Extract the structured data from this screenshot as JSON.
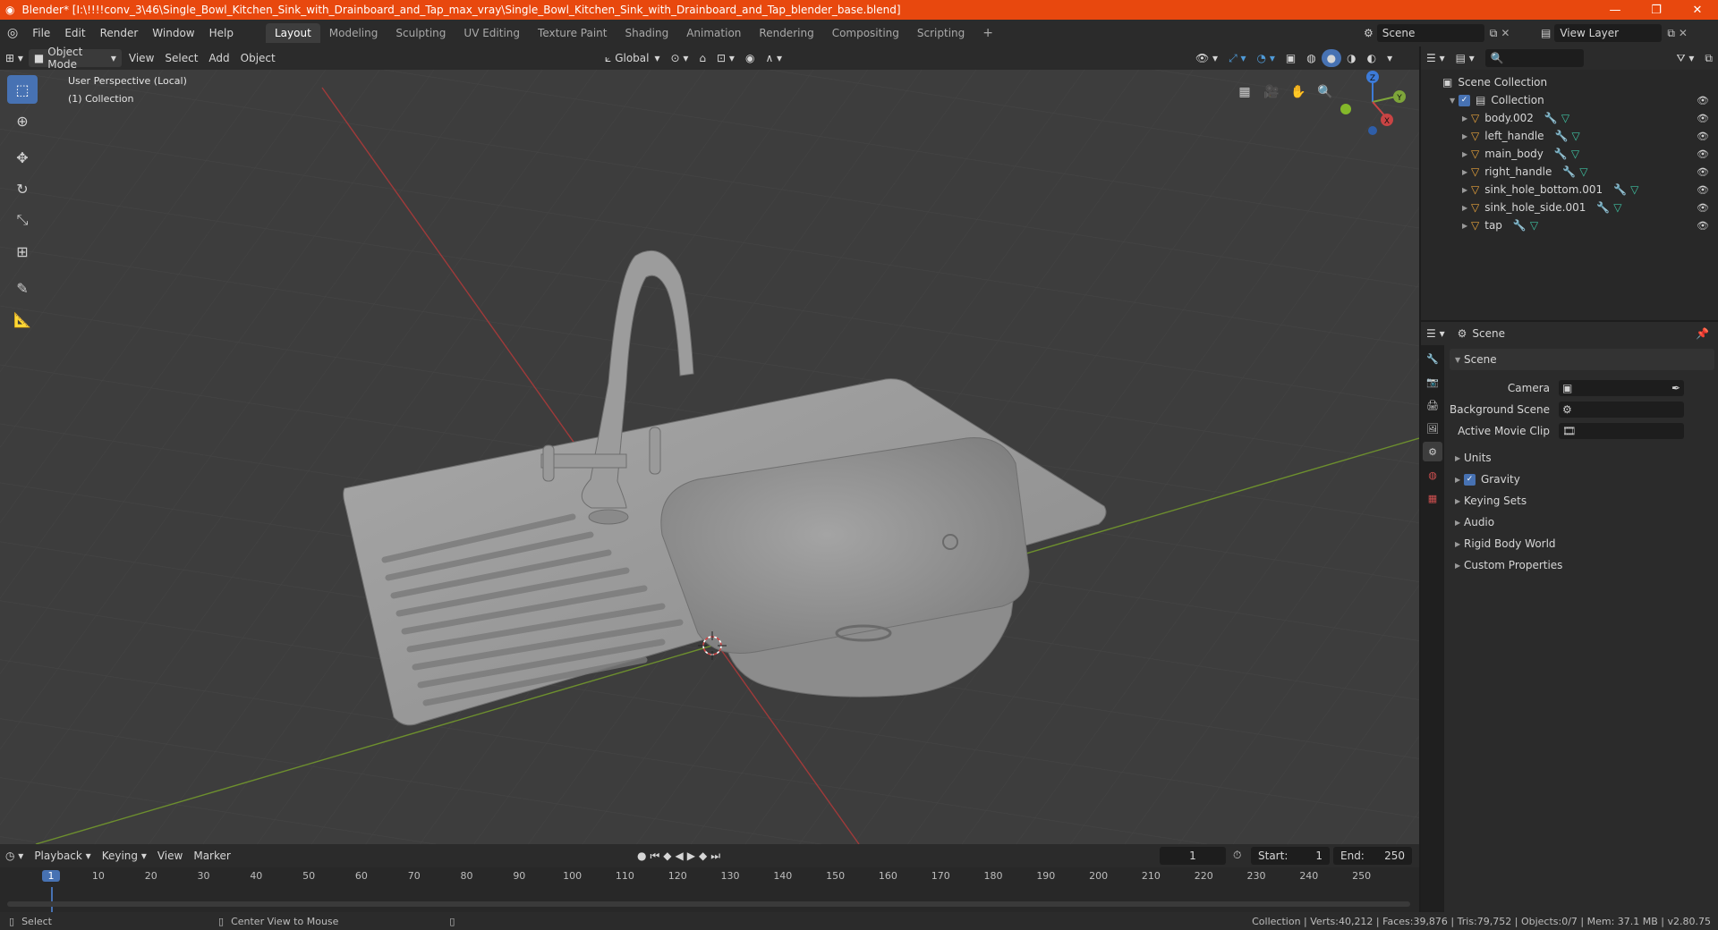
{
  "title": "Blender* [I:\\!!!!conv_3\\46\\Single_Bowl_Kitchen_Sink_with_Drainboard_and_Tap_max_vray\\Single_Bowl_Kitchen_Sink_with_Drainboard_and_Tap_blender_base.blend]",
  "menu": [
    "File",
    "Edit",
    "Render",
    "Window",
    "Help"
  ],
  "workspaces": [
    "Layout",
    "Modeling",
    "Sculpting",
    "UV Editing",
    "Texture Paint",
    "Shading",
    "Animation",
    "Rendering",
    "Compositing",
    "Scripting"
  ],
  "active_workspace": "Layout",
  "scene_name": "Scene",
  "view_layer": "View Layer",
  "viewport": {
    "mode": "Object Mode",
    "menus": [
      "View",
      "Select",
      "Add",
      "Object"
    ],
    "orientation": "Global",
    "perspective_label": "User Perspective (Local)",
    "collection_label": "(1) Collection",
    "gizmo": {
      "x": "X",
      "y": "Y",
      "z": "Z"
    }
  },
  "outliner": {
    "root": "Scene Collection",
    "collection": "Collection",
    "objects": [
      "body.002",
      "left_handle",
      "main_body",
      "right_handle",
      "sink_hole_bottom.001",
      "sink_hole_side.001",
      "tap"
    ]
  },
  "properties": {
    "context": "Scene",
    "panel_title": "Scene",
    "fields": [
      {
        "label": "Camera",
        "value": ""
      },
      {
        "label": "Background Scene",
        "value": ""
      },
      {
        "label": "Active Movie Clip",
        "value": ""
      }
    ],
    "sections": [
      "Units",
      "Gravity",
      "Keying Sets",
      "Audio",
      "Rigid Body World",
      "Custom Properties"
    ],
    "gravity_checked": true
  },
  "timeline": {
    "menus": [
      "Playback",
      "Keying",
      "View",
      "Marker"
    ],
    "current_frame": "1",
    "start_label": "Start:",
    "start": "1",
    "end_label": "End:",
    "end": "250",
    "ticks": [
      "1",
      "10",
      "20",
      "30",
      "40",
      "50",
      "60",
      "70",
      "80",
      "90",
      "100",
      "110",
      "120",
      "130",
      "140",
      "150",
      "160",
      "170",
      "180",
      "190",
      "200",
      "210",
      "220",
      "230",
      "240",
      "250"
    ]
  },
  "status": {
    "left": "Select",
    "middle": "Center View to Mouse",
    "right": "Collection | Verts:40,212 | Faces:39,876 | Tris:79,752 | Objects:0/7 | Mem: 37.1 MB | v2.80.75"
  },
  "colors": {
    "titlebar": "#e8480e",
    "accent": "#4772b3",
    "viewport_bg": "#3d3d3d",
    "x_axis": "#c94444",
    "y_axis": "#7ea53a",
    "z_axis": "#3d7bd8",
    "object_icon": "#e8a33c",
    "modifier_icon": "#5aa0e0",
    "mesh_icon": "#3fc2a2"
  }
}
